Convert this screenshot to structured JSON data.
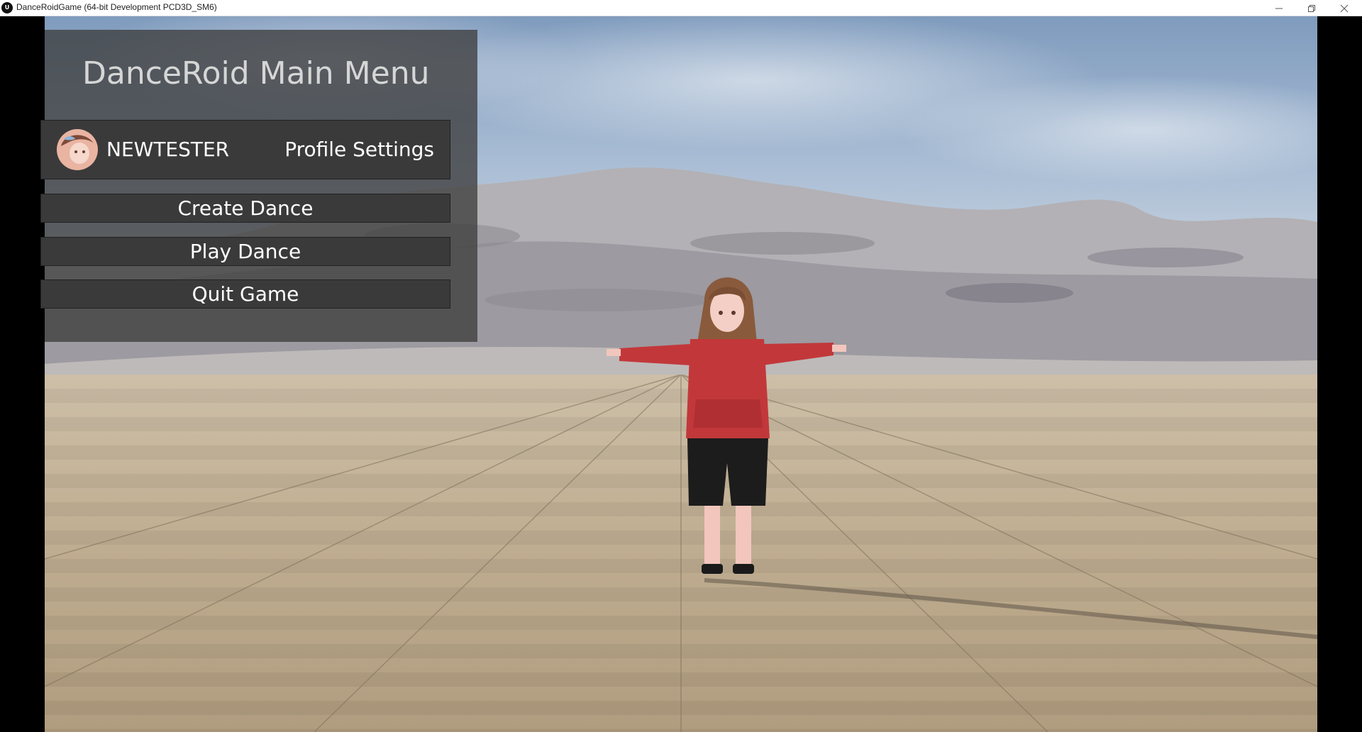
{
  "window": {
    "app_icon_label": "U",
    "title": "DanceRoidGame (64-bit Development PCD3D_SM6)",
    "controls": [
      "minimize-icon",
      "restore-icon",
      "close-icon"
    ]
  },
  "menu": {
    "title": "DanceRoid Main Menu",
    "profile": {
      "username": "NEWTESTER",
      "settings_label": "Profile Settings"
    },
    "buttons": {
      "create_dance": "Create Dance",
      "play_dance": "Play Dance",
      "quit_game": "Quit Game"
    }
  },
  "colors": {
    "panel": "#3e3e3e",
    "button": "#3a3a3a",
    "title_text": "#d6d6d6",
    "button_text": "#ffffff",
    "hoodie": "#c2383a"
  }
}
